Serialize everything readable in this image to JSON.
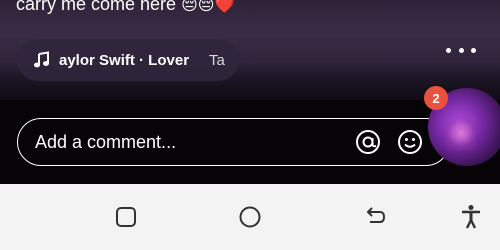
{
  "caption": {
    "text": "carry me come here",
    "emojis": "😔😔❤️"
  },
  "music": {
    "icon": "music-note-icon",
    "track": "aylor Swift · Lover",
    "next_track": "Ta"
  },
  "more_icon": "more-horizontal-icon",
  "comment": {
    "placeholder": "Add a comment...",
    "mention_icon": "at-icon",
    "emoji_icon": "smiley-icon"
  },
  "avatar": {
    "badge_count": "2"
  },
  "navbar": {
    "recents_icon": "square-icon",
    "home_icon": "circle-icon",
    "back_icon": "back-arrow-icon",
    "accessibility_icon": "accessibility-icon"
  },
  "colors": {
    "badge": "#e8523f",
    "navbar": "#f3f3f3",
    "comment_border": "#ffffff"
  }
}
